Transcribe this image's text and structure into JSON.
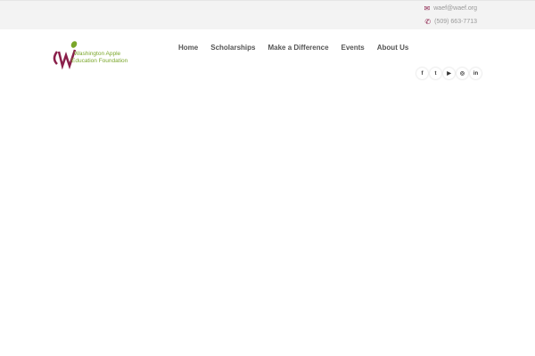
{
  "contact": {
    "email": "waef@waef.org",
    "phone": "(509) 663-7713"
  },
  "logo": {
    "line1": "Washington Apple",
    "line2": "Education Foundation"
  },
  "nav": [
    "Home",
    "Scholarships",
    "Make a Difference",
    "Events",
    "About Us"
  ],
  "social": [
    {
      "name": "facebook",
      "glyph": "f"
    },
    {
      "name": "twitter",
      "glyph": "t"
    },
    {
      "name": "youtube",
      "glyph": "▶"
    },
    {
      "name": "instagram",
      "glyph": "◎"
    },
    {
      "name": "linkedin",
      "glyph": "in"
    }
  ],
  "colors": {
    "brand": "#8a1f4a",
    "leaf": "#7aa62a"
  }
}
